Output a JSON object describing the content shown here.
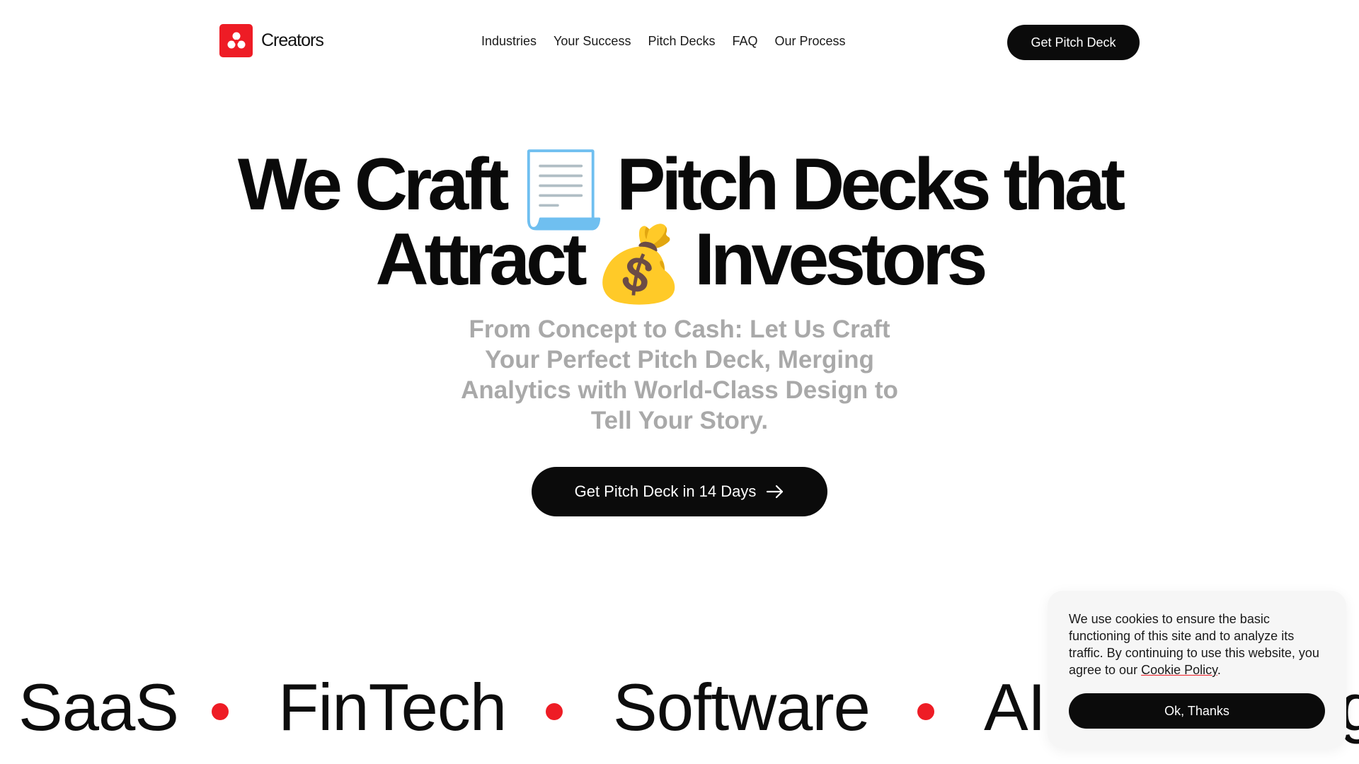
{
  "brand": {
    "name": "Creators",
    "logo_icon": "creators-logo-icon",
    "accent": "#ee1c25"
  },
  "nav": {
    "links": [
      "Industries",
      "Your Success",
      "Pitch Decks",
      "FAQ",
      "Our Process"
    ],
    "cta": "Get Pitch Deck"
  },
  "hero": {
    "title_line1_a": "We Craft",
    "title_line1_b": "Pitch Decks that",
    "title_line2_a": "Attract",
    "title_line2_b": "Investors",
    "emoji_1": "📃",
    "emoji_2": "💰",
    "subtitle": "From Concept to Cash: Let Us Craft Your Perfect Pitch Deck, Merging Analytics with World-Class Design to Tell Your Story.",
    "cta": "Get Pitch Deck in 14 Days",
    "cta_icon": "arrow-right-icon"
  },
  "marquee": {
    "items": [
      "SaaS",
      "FinTech",
      "Software",
      "AI",
      "g"
    ]
  },
  "cookie": {
    "text": "We use cookies to ensure the basic functioning of this site and to analyze its traffic. By continuing to use this website, you agree to our",
    "link": "Cookie Policy",
    "period": ".",
    "button": "Ok, Thanks"
  }
}
